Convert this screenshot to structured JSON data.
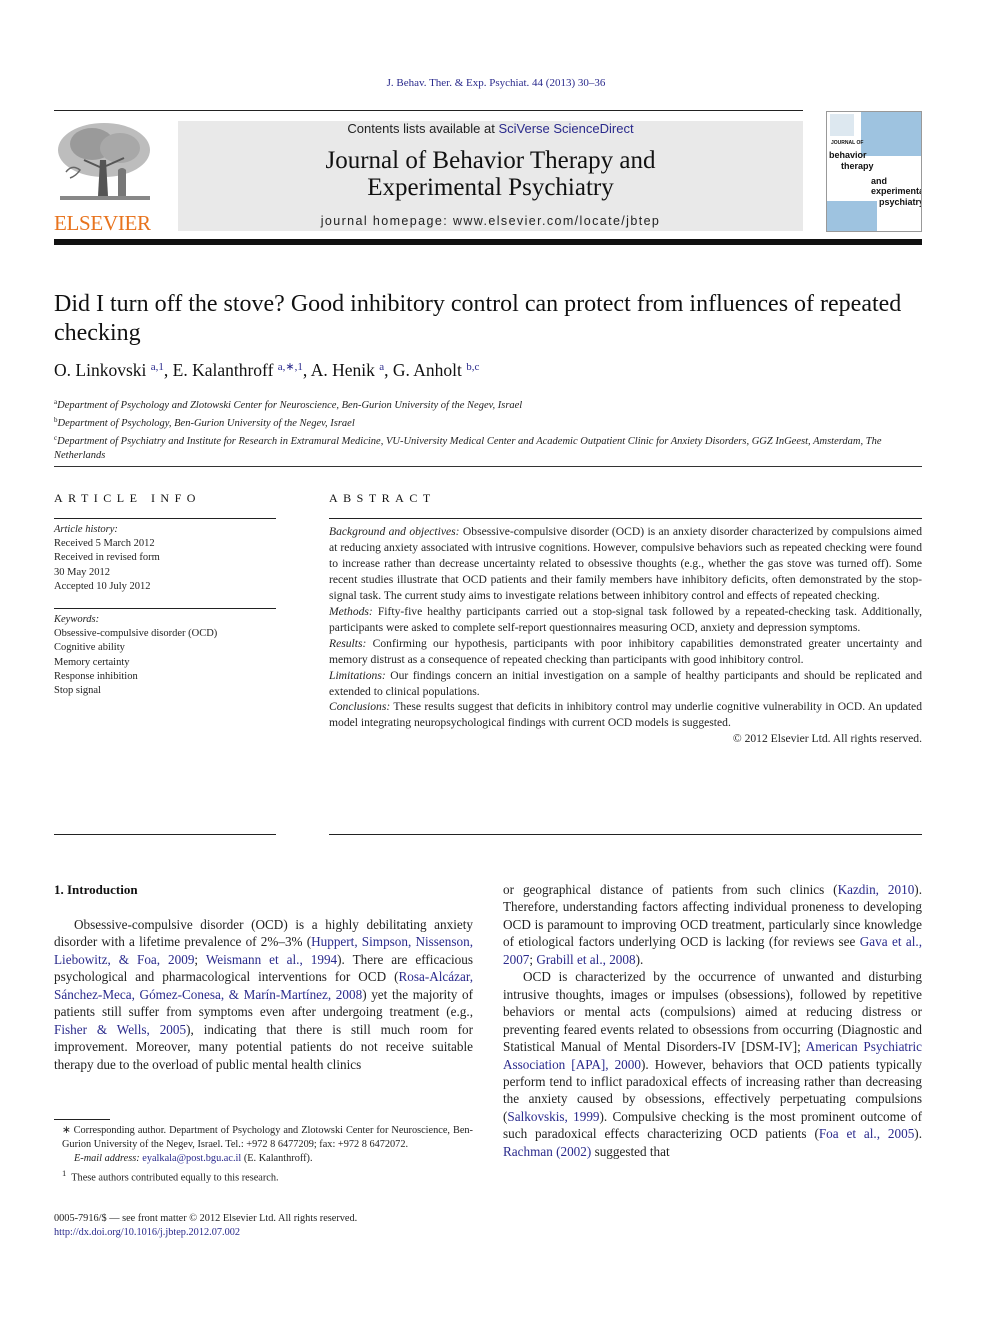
{
  "header": {
    "citation": "J. Behav. Ther. & Exp. Psychiat. 44 (2013) 30–36",
    "publisher_logo_text": "ELSEVIER",
    "contents_prefix": "Contents lists available at ",
    "contents_link": "SciVerse ScienceDirect",
    "journal_title_line1": "Journal of Behavior Therapy and",
    "journal_title_line2": "Experimental Psychiatry",
    "homepage": "journal homepage: www.elsevier.com/locate/jbtep",
    "cover": {
      "top": "JOURNAL OF",
      "l1": "behavior",
      "l2": "therapy",
      "l3": "and",
      "l4": "experimental",
      "l5": "psychiatry"
    },
    "colors": {
      "logo_orange": "#e8731d",
      "link_blue": "#2a2a8c",
      "cover_blue": "#9ec3e0",
      "masthead_gray": "#e9e9e9"
    }
  },
  "article": {
    "title": "Did I turn off the stove? Good inhibitory control can protect from influences of repeated checking",
    "authors": [
      {
        "name": "O. Linkovski",
        "sup": "a,1"
      },
      {
        "name": "E. Kalanthroff",
        "sup": "a,∗,1"
      },
      {
        "name": "A. Henik",
        "sup": "a"
      },
      {
        "name": "G. Anholt",
        "sup": "b,c"
      }
    ],
    "affiliations": [
      {
        "mark": "a",
        "text": "Department of Psychology and Zlotowski Center for Neuroscience, Ben-Gurion University of the Negev, Israel"
      },
      {
        "mark": "b",
        "text": "Department of Psychology, Ben-Gurion University of the Negev, Israel"
      },
      {
        "mark": "c",
        "text": "Department of Psychiatry and Institute for Research in Extramural Medicine, VU-University Medical Center and Academic Outpatient Clinic for Anxiety Disorders, GGZ InGeest, Amsterdam, The Netherlands"
      }
    ]
  },
  "article_info": {
    "label": "ARTICLE INFO",
    "history_heading": "Article history:",
    "history": [
      "Received 5 March 2012",
      "Received in revised form",
      "30 May 2012",
      "Accepted 10 July 2012"
    ],
    "keywords_heading": "Keywords:",
    "keywords": [
      "Obsessive-compulsive disorder (OCD)",
      "Cognitive ability",
      "Memory certainty",
      "Response inhibition",
      "Stop signal"
    ]
  },
  "abstract": {
    "label": "ABSTRACT",
    "sections": [
      {
        "lead": "Background and objectives:",
        "text": " Obsessive-compulsive disorder (OCD) is an anxiety disorder characterized by compulsions aimed at reducing anxiety associated with intrusive cognitions. However, compulsive behaviors such as repeated checking were found to increase rather than decrease uncertainty related to obsessive thoughts (e.g., whether the gas stove was turned off). Some recent studies illustrate that OCD patients and their family members have inhibitory deficits, often demonstrated by the stop-signal task. The current study aims to investigate relations between inhibitory control and effects of repeated checking."
      },
      {
        "lead": "Methods:",
        "text": " Fifty-five healthy participants carried out a stop-signal task followed by a repeated-checking task. Additionally, participants were asked to complete self-report questionnaires measuring OCD, anxiety and depression symptoms."
      },
      {
        "lead": "Results:",
        "text": " Confirming our hypothesis, participants with poor inhibitory capabilities demonstrated greater uncertainty and memory distrust as a consequence of repeated checking than participants with good inhibitory control."
      },
      {
        "lead": "Limitations:",
        "text": " Our findings concern an initial investigation on a sample of healthy participants and should be replicated and extended to clinical populations."
      },
      {
        "lead": "Conclusions:",
        "text": " These results suggest that deficits in inhibitory control may underlie cognitive vulnerability in OCD. An updated model integrating neuropsychological findings with current OCD models is suggested."
      }
    ],
    "copyright": "© 2012 Elsevier Ltd. All rights reserved."
  },
  "body": {
    "intro_heading": "1.  Introduction",
    "p1": [
      {
        "t": "Obsessive-compulsive disorder (OCD) is a highly debilitating anxiety disorder with a lifetime prevalence of 2%–3% ("
      },
      {
        "t": "Huppert, Simpson, Nissenson, Liebowitz, & Foa, 2009",
        "link": true
      },
      {
        "t": "; "
      },
      {
        "t": "Weismann et al., 1994",
        "link": true
      },
      {
        "t": "). There are efficacious psychological and pharmacological interventions for OCD ("
      },
      {
        "t": "Rosa-Alcázar, Sánchez-Meca, Gómez-Conesa, & Marín-Martínez, 2008",
        "link": true
      },
      {
        "t": ") yet the majority of patients still suffer from symptoms even after undergoing treatment (e.g., "
      },
      {
        "t": "Fisher & Wells, 2005",
        "link": true
      },
      {
        "t": "), indicating that there is still much room for improvement. Moreover, many potential patients do not receive suitable therapy due to the overload of public mental health clinics or geographical distance of patients from such clinics ("
      },
      {
        "t": "Kazdin, 2010",
        "link": true
      },
      {
        "t": "). Therefore, understanding factors affecting individual proneness to developing OCD is paramount to improving OCD treatment, particularly since knowledge of etiological factors underlying OCD is lacking (for reviews see "
      },
      {
        "t": "Gava et al., 2007",
        "link": true
      },
      {
        "t": "; "
      },
      {
        "t": "Grabill et al., 2008",
        "link": true
      },
      {
        "t": ")."
      }
    ],
    "p1_left_a": "Obsessive-compulsive disorder (OCD) is a highly debilitating anxiety disorder with a lifetime prevalence of 2%–3% (",
    "p1_left_link1": "Huppert, Simpson, Nissenson, Liebowitz, & Foa, 2009",
    "p1_left_b": "; ",
    "p1_left_link2": "Weismann et al., 1994",
    "p1_left_c": "). There are efficacious psychological and pharmacological interventions for OCD (",
    "p1_left_link3": "Rosa-Alcázar, Sánchez-Meca, Gómez-Conesa, & Marín-Martínez, 2008",
    "p1_left_d": ") yet the majority of patients still suffer from symptoms even after undergoing treatment (e.g., ",
    "p1_left_link4": "Fisher & Wells, 2005",
    "p1_left_e": "), indicating that there is still much room for improvement. Moreover, many potential patients do not receive suitable therapy due to the overload of public mental health clinics",
    "p1_right_a": "or geographical distance of patients from such clinics (",
    "p1_right_link1": "Kazdin, 2010",
    "p1_right_b": "). Therefore, understanding factors affecting individual proneness to developing OCD is paramount to improving OCD treatment, particularly since knowledge of etiological factors underlying OCD is lacking (for reviews see ",
    "p1_right_link2": "Gava et al., 2007",
    "p1_right_c": "; ",
    "p1_right_link3": "Grabill et al., 2008",
    "p1_right_d": ").",
    "p2_a": "OCD is characterized by the occurrence of unwanted and disturbing intrusive thoughts, images or impulses (obsessions), followed by repetitive behaviors or mental acts (compulsions) aimed at reducing distress or preventing feared events related to obsessions from occurring (Diagnostic and Statistical Manual of Mental Disorders-IV [DSM-IV]; ",
    "p2_link1": "American Psychiatric Association [APA], 2000",
    "p2_b": "). However, behaviors that OCD patients typically perform tend to inflict paradoxical effects of increasing rather than decreasing the anxiety caused by obsessions, effectively perpetuating compulsions (",
    "p2_link2": "Salkovskis, 1999",
    "p2_c": "). Compulsive checking is the most prominent outcome of such paradoxical effects characterizing OCD patients (",
    "p2_link3": "Foa et al., 2005",
    "p2_d": "). ",
    "p2_link4": "Rachman (2002)",
    "p2_e": " suggested that"
  },
  "footnotes": {
    "corresponding": "∗ Corresponding author. Department of Psychology and Zlotowski Center for Neuroscience, Ben-Gurion University of the Negev, Israel. Tel.: +972 8 6477209; fax: +972 8 6472072.",
    "email_label": "E-mail address:",
    "email": "eyalkala@post.bgu.ac.il",
    "email_suffix": " (E. Kalanthroff).",
    "equal_mark": "1",
    "equal": "These authors contributed equally to this research.",
    "front_matter": "0005-7916/$ — see front matter © 2012 Elsevier Ltd. All rights reserved.",
    "doi": "http://dx.doi.org/10.1016/j.jbtep.2012.07.002"
  }
}
